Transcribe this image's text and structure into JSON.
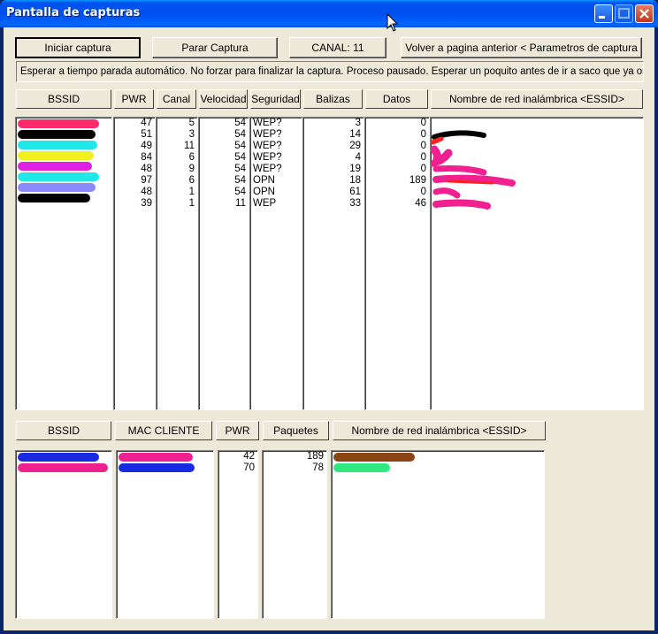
{
  "window": {
    "title": "Pantalla de capturas"
  },
  "toolbar": {
    "start_label": "Iniciar captura",
    "stop_label": "Parar Captura",
    "channel_label": "CANAL: 11",
    "back_label": "Volver a pagina anterior  < Parametros de captura >"
  },
  "status": {
    "text": "Esperar a tiempo parada automático. No forzar para finalizar la captura.  Proceso pausado.  Esperar un poquito antes de ir a saco que ya os conozco"
  },
  "networks": {
    "headers": {
      "bssid": "BSSID",
      "pwr": "PWR",
      "canal": "Canal",
      "velocidad": "Velocidad",
      "seguridad": "Seguridad",
      "balizas": "Balizas",
      "datos": "Datos",
      "essid": "Nombre de red inalámbrica  <ESSID>"
    },
    "pwr": [
      "47",
      "51",
      "49",
      "84",
      "48",
      "97",
      "48",
      "39"
    ],
    "canal": [
      "5",
      "3",
      "11",
      "6",
      "9",
      "6",
      "1",
      "1"
    ],
    "velocidad": [
      "54",
      "54",
      "54",
      "54",
      "54",
      "54",
      "54",
      "11"
    ],
    "seguridad": [
      "WEP?",
      "WEP?",
      "WEP?",
      "WEP?",
      "WEP?",
      "OPN",
      "OPN",
      "WEP"
    ],
    "balizas": [
      "3",
      "14",
      "29",
      "4",
      "19",
      "18",
      "61",
      "33"
    ],
    "datos": [
      "0",
      "0",
      "0",
      "0",
      "0",
      "189",
      "0",
      "46"
    ],
    "bssid_redaction_colors": [
      "#ff2a6a",
      "#000000",
      "#20e8e8",
      "#f0f020",
      "#e020e0",
      "#20e8e8",
      "#8a8aff",
      "#000000"
    ]
  },
  "clients": {
    "headers": {
      "bssid": "BSSID",
      "mac": "MAC CLIENTE",
      "pwr": "PWR",
      "paquetes": "Paquetes",
      "essid": "Nombre de red inalámbrica  <ESSID>"
    },
    "pwr": [
      "42",
      "70"
    ],
    "paquetes": [
      "189",
      "78"
    ],
    "bssid_redaction_colors": [
      "#1a2ae0",
      "#f02090"
    ],
    "mac_redaction_colors": [
      "#f02090",
      "#1a2ae0"
    ],
    "essid_redaction_colors": [
      "#8b4513",
      "#30e880"
    ]
  }
}
